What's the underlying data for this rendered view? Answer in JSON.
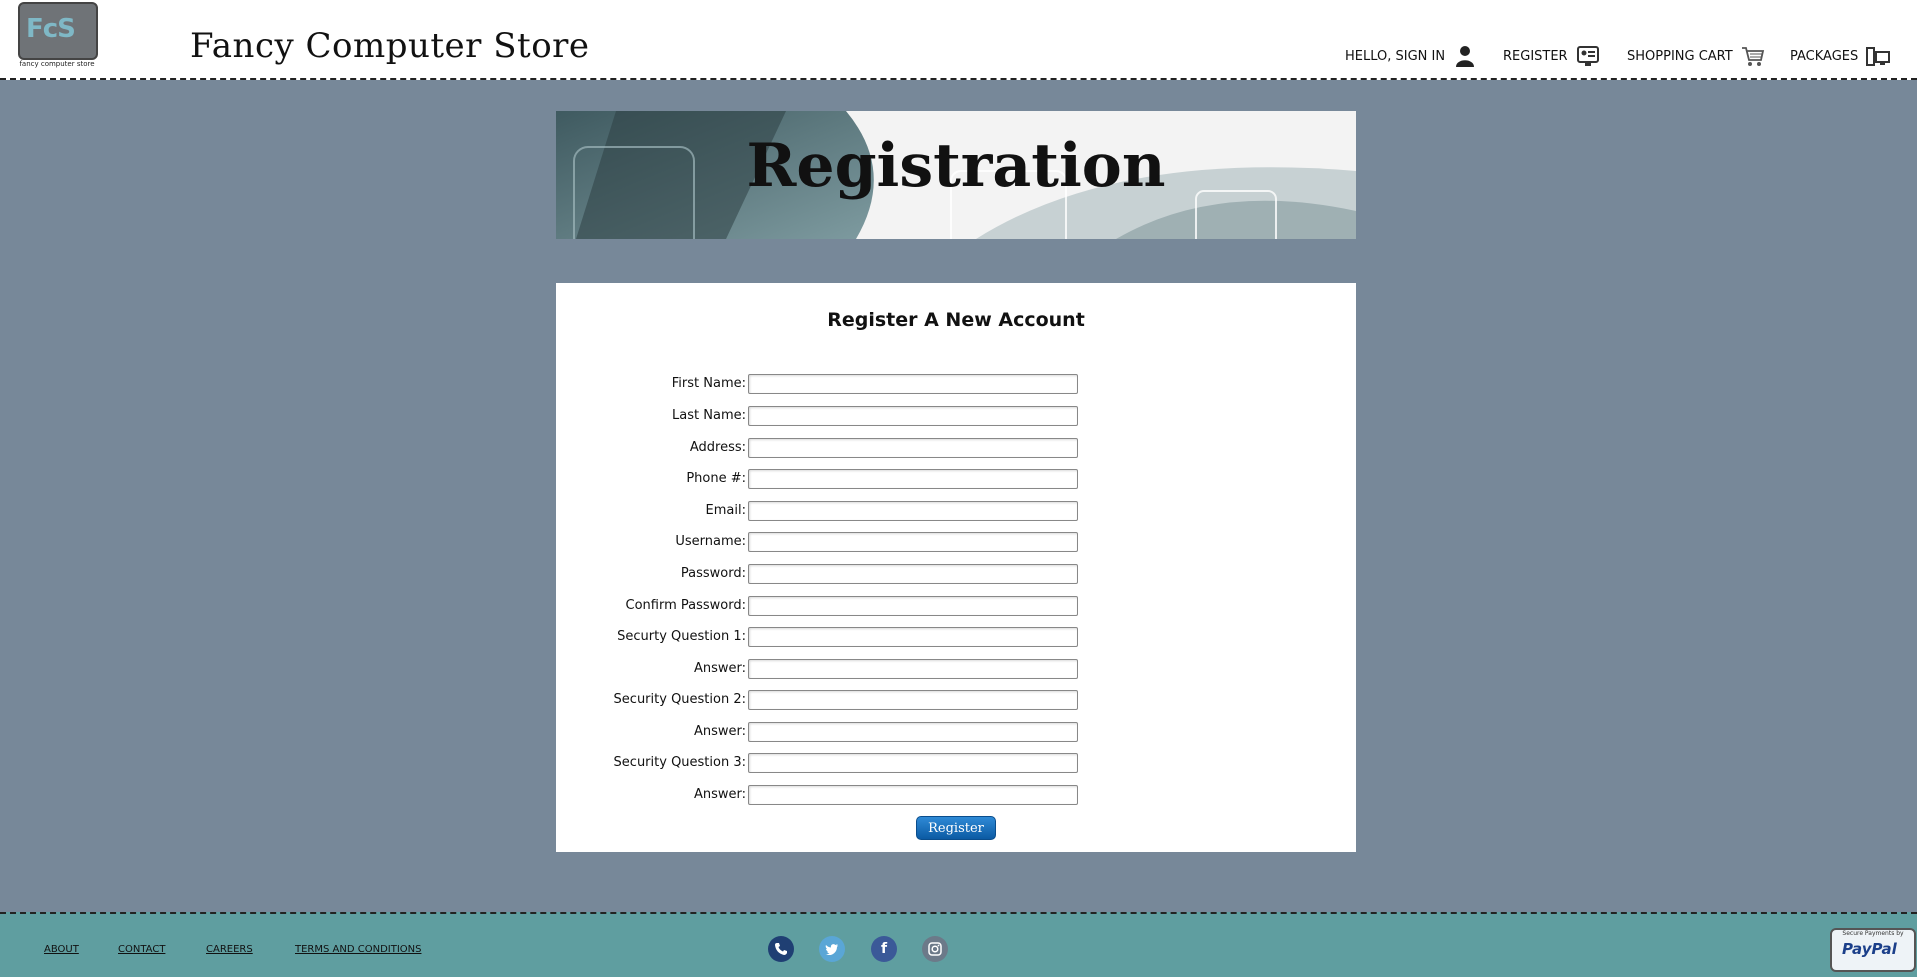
{
  "header": {
    "logo_letters": "FcS",
    "logo_caption": "fancy computer store",
    "store_title": "Fancy Computer Store",
    "nav": [
      {
        "label": "Hello, Sign In",
        "icon": "user-icon"
      },
      {
        "label": "Register",
        "icon": "register-card-icon"
      },
      {
        "label": "Shopping Cart",
        "icon": "shopping-cart-icon"
      },
      {
        "label": "Packages",
        "icon": "computer-package-icon"
      }
    ]
  },
  "banner": {
    "title": "Registration"
  },
  "form": {
    "heading": "Register A New Account",
    "fields": [
      {
        "label": "First Name:",
        "value": ""
      },
      {
        "label": "Last Name:",
        "value": ""
      },
      {
        "label": "Address:",
        "value": ""
      },
      {
        "label": "Phone #:",
        "value": ""
      },
      {
        "label": "Email:",
        "value": ""
      },
      {
        "label": "Username:",
        "value": ""
      },
      {
        "label": "Password:",
        "value": ""
      },
      {
        "label": "Confirm Password:",
        "value": ""
      },
      {
        "label": "Securty Question 1:",
        "value": ""
      },
      {
        "label": "Answer:",
        "value": ""
      },
      {
        "label": "Security Question 2:",
        "value": ""
      },
      {
        "label": "Answer:",
        "value": ""
      },
      {
        "label": "Security Question 3:",
        "value": ""
      },
      {
        "label": "Answer:",
        "value": ""
      }
    ],
    "submit_label": "Register"
  },
  "footer": {
    "links": [
      "About",
      "Contact",
      "Careers",
      "Terms and Conditions"
    ],
    "social": [
      {
        "icon": "phone-icon",
        "color": "#1f3f73"
      },
      {
        "icon": "twitter-icon",
        "color": "#5aa6d6"
      },
      {
        "icon": "facebook-icon",
        "color": "#3b5998"
      },
      {
        "icon": "instagram-icon",
        "color": "#6c7a89"
      }
    ],
    "paypal_caption": "Secure Payments by",
    "paypal_word": "PayPal"
  },
  "colors": {
    "page_background": "#778899",
    "footer_background": "#5f9ea0",
    "button_blue": "#0b5aa3"
  }
}
